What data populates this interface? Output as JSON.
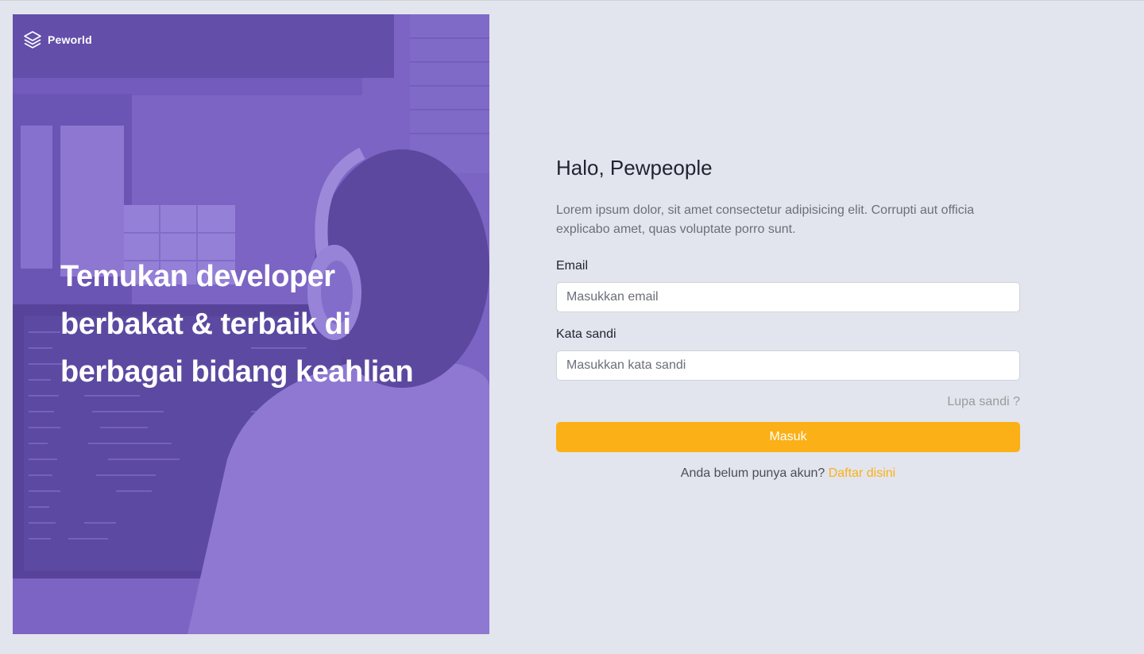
{
  "brand": {
    "name": "Peworld",
    "logo_icon": "layers-icon"
  },
  "hero": {
    "heading_lines": [
      "Temukan developer",
      "berbakat & terbaik di",
      "berbagai bidang keahlian"
    ],
    "overlay_color": "#785FC8"
  },
  "form": {
    "title": "Halo, Pewpeople",
    "description": "Lorem ipsum dolor, sit amet consectetur adipisicing elit. Corrupti aut officia explicabo amet, quas voluptate porro sunt.",
    "email_label": "Email",
    "email_placeholder": "Masukkan email",
    "password_label": "Kata sandi",
    "password_placeholder": "Masukkan kata sandi",
    "forgot_label": "Lupa sandi ?",
    "submit_label": "Masuk",
    "register_prompt": "Anda belum punya akun?",
    "register_link": "Daftar disini"
  },
  "colors": {
    "accent": "#FBB017",
    "background": "#E2E5ED",
    "hero_purple": "#5E4BA3"
  }
}
